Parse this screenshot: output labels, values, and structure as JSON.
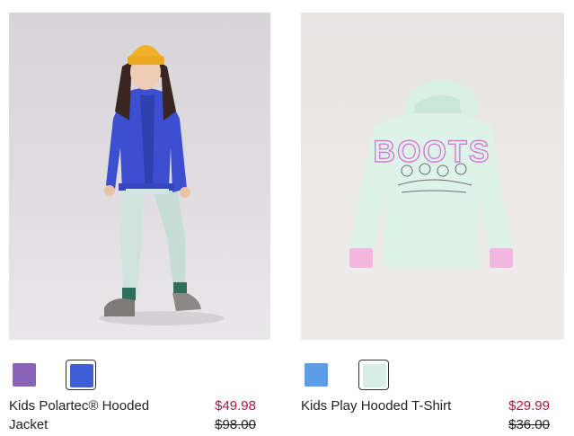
{
  "products": [
    {
      "name": "Kids Polartec® Hooded Jacket",
      "sale_price": "$49.98",
      "original_price": "$98.00",
      "swatches": [
        {
          "color": "#8a62b8",
          "selected": false
        },
        {
          "color": "#3f5fd6",
          "selected": true
        }
      ]
    },
    {
      "name": "Kids Play Hooded T-Shirt",
      "sale_price": "$29.99",
      "original_price": "$36.00",
      "swatches": [
        {
          "color": "#5b9de6",
          "selected": false
        },
        {
          "color": "#d6eee4",
          "selected": true
        }
      ]
    }
  ],
  "graphic_text": "BOOTS"
}
